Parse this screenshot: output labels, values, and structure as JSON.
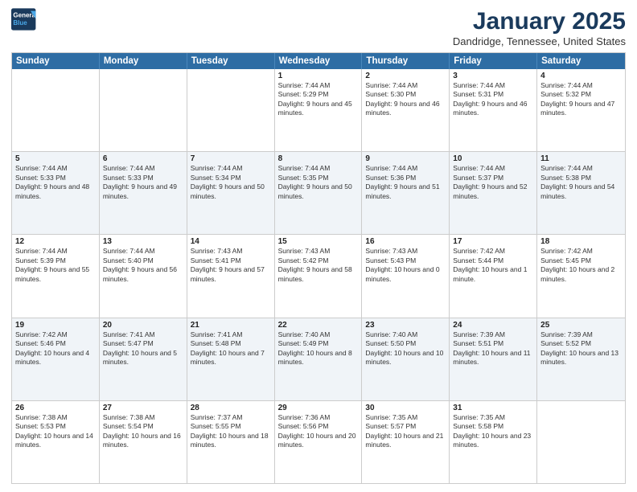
{
  "header": {
    "logo_line1": "General",
    "logo_line2": "Blue",
    "month_title": "January 2025",
    "location": "Dandridge, Tennessee, United States"
  },
  "weekdays": [
    "Sunday",
    "Monday",
    "Tuesday",
    "Wednesday",
    "Thursday",
    "Friday",
    "Saturday"
  ],
  "rows": [
    {
      "alt": false,
      "cells": [
        {
          "day": "",
          "info": ""
        },
        {
          "day": "",
          "info": ""
        },
        {
          "day": "",
          "info": ""
        },
        {
          "day": "1",
          "info": "Sunrise: 7:44 AM\nSunset: 5:29 PM\nDaylight: 9 hours and 45 minutes."
        },
        {
          "day": "2",
          "info": "Sunrise: 7:44 AM\nSunset: 5:30 PM\nDaylight: 9 hours and 46 minutes."
        },
        {
          "day": "3",
          "info": "Sunrise: 7:44 AM\nSunset: 5:31 PM\nDaylight: 9 hours and 46 minutes."
        },
        {
          "day": "4",
          "info": "Sunrise: 7:44 AM\nSunset: 5:32 PM\nDaylight: 9 hours and 47 minutes."
        }
      ]
    },
    {
      "alt": true,
      "cells": [
        {
          "day": "5",
          "info": "Sunrise: 7:44 AM\nSunset: 5:33 PM\nDaylight: 9 hours and 48 minutes."
        },
        {
          "day": "6",
          "info": "Sunrise: 7:44 AM\nSunset: 5:33 PM\nDaylight: 9 hours and 49 minutes."
        },
        {
          "day": "7",
          "info": "Sunrise: 7:44 AM\nSunset: 5:34 PM\nDaylight: 9 hours and 50 minutes."
        },
        {
          "day": "8",
          "info": "Sunrise: 7:44 AM\nSunset: 5:35 PM\nDaylight: 9 hours and 50 minutes."
        },
        {
          "day": "9",
          "info": "Sunrise: 7:44 AM\nSunset: 5:36 PM\nDaylight: 9 hours and 51 minutes."
        },
        {
          "day": "10",
          "info": "Sunrise: 7:44 AM\nSunset: 5:37 PM\nDaylight: 9 hours and 52 minutes."
        },
        {
          "day": "11",
          "info": "Sunrise: 7:44 AM\nSunset: 5:38 PM\nDaylight: 9 hours and 54 minutes."
        }
      ]
    },
    {
      "alt": false,
      "cells": [
        {
          "day": "12",
          "info": "Sunrise: 7:44 AM\nSunset: 5:39 PM\nDaylight: 9 hours and 55 minutes."
        },
        {
          "day": "13",
          "info": "Sunrise: 7:44 AM\nSunset: 5:40 PM\nDaylight: 9 hours and 56 minutes."
        },
        {
          "day": "14",
          "info": "Sunrise: 7:43 AM\nSunset: 5:41 PM\nDaylight: 9 hours and 57 minutes."
        },
        {
          "day": "15",
          "info": "Sunrise: 7:43 AM\nSunset: 5:42 PM\nDaylight: 9 hours and 58 minutes."
        },
        {
          "day": "16",
          "info": "Sunrise: 7:43 AM\nSunset: 5:43 PM\nDaylight: 10 hours and 0 minutes."
        },
        {
          "day": "17",
          "info": "Sunrise: 7:42 AM\nSunset: 5:44 PM\nDaylight: 10 hours and 1 minute."
        },
        {
          "day": "18",
          "info": "Sunrise: 7:42 AM\nSunset: 5:45 PM\nDaylight: 10 hours and 2 minutes."
        }
      ]
    },
    {
      "alt": true,
      "cells": [
        {
          "day": "19",
          "info": "Sunrise: 7:42 AM\nSunset: 5:46 PM\nDaylight: 10 hours and 4 minutes."
        },
        {
          "day": "20",
          "info": "Sunrise: 7:41 AM\nSunset: 5:47 PM\nDaylight: 10 hours and 5 minutes."
        },
        {
          "day": "21",
          "info": "Sunrise: 7:41 AM\nSunset: 5:48 PM\nDaylight: 10 hours and 7 minutes."
        },
        {
          "day": "22",
          "info": "Sunrise: 7:40 AM\nSunset: 5:49 PM\nDaylight: 10 hours and 8 minutes."
        },
        {
          "day": "23",
          "info": "Sunrise: 7:40 AM\nSunset: 5:50 PM\nDaylight: 10 hours and 10 minutes."
        },
        {
          "day": "24",
          "info": "Sunrise: 7:39 AM\nSunset: 5:51 PM\nDaylight: 10 hours and 11 minutes."
        },
        {
          "day": "25",
          "info": "Sunrise: 7:39 AM\nSunset: 5:52 PM\nDaylight: 10 hours and 13 minutes."
        }
      ]
    },
    {
      "alt": false,
      "cells": [
        {
          "day": "26",
          "info": "Sunrise: 7:38 AM\nSunset: 5:53 PM\nDaylight: 10 hours and 14 minutes."
        },
        {
          "day": "27",
          "info": "Sunrise: 7:38 AM\nSunset: 5:54 PM\nDaylight: 10 hours and 16 minutes."
        },
        {
          "day": "28",
          "info": "Sunrise: 7:37 AM\nSunset: 5:55 PM\nDaylight: 10 hours and 18 minutes."
        },
        {
          "day": "29",
          "info": "Sunrise: 7:36 AM\nSunset: 5:56 PM\nDaylight: 10 hours and 20 minutes."
        },
        {
          "day": "30",
          "info": "Sunrise: 7:35 AM\nSunset: 5:57 PM\nDaylight: 10 hours and 21 minutes."
        },
        {
          "day": "31",
          "info": "Sunrise: 7:35 AM\nSunset: 5:58 PM\nDaylight: 10 hours and 23 minutes."
        },
        {
          "day": "",
          "info": ""
        }
      ]
    }
  ]
}
